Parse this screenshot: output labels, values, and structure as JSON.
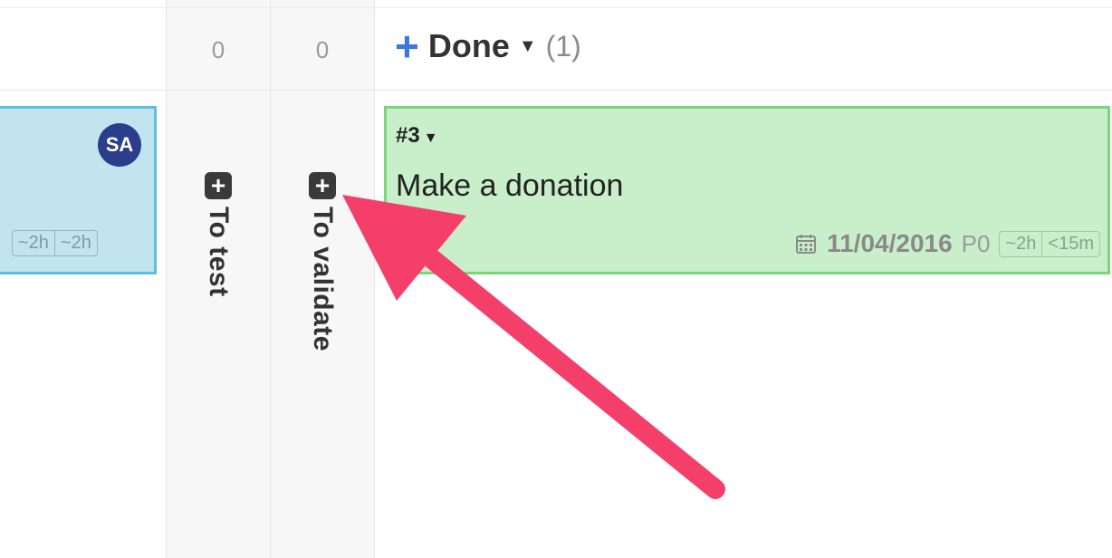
{
  "columns": {
    "to_test": {
      "count": "0",
      "label": "To test"
    },
    "to_validate": {
      "count": "0",
      "label": "To validate"
    },
    "done": {
      "add_symbol": "+",
      "title": "Done",
      "count": "(1)"
    }
  },
  "left_card": {
    "assignee_initials": "SA",
    "estimates": [
      "~2h",
      "~2h"
    ]
  },
  "done_card": {
    "id": "#3",
    "title": "Make a donation",
    "due_date": "11/04/2016",
    "priority": "P0",
    "estimates": [
      "~2h",
      "<15m"
    ]
  },
  "icons": {
    "add_column_icon": "plus-square",
    "calendar_icon": "calendar",
    "caret_icon": "caret-down",
    "annotation": "pointer-arrow"
  },
  "colors": {
    "blue_card_bg": "#c1e4ef",
    "blue_card_border": "#5bc0de",
    "green_card_bg": "#c8efc9",
    "green_card_border": "#79d67b",
    "add_button": "#3b78d8",
    "arrow": "#f43f6b",
    "avatar": "#2b3e8e"
  }
}
